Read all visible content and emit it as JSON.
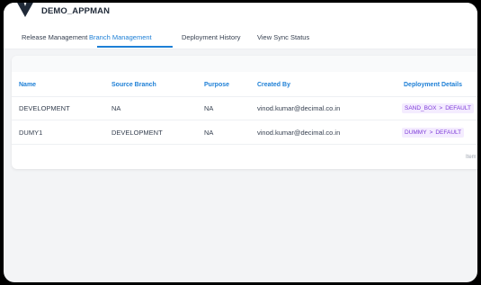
{
  "app": {
    "title": "DEMO_APPMAN"
  },
  "tabs": [
    {
      "label": "Release Management"
    },
    {
      "label": "Branch Management"
    },
    {
      "label": "Deployment History"
    },
    {
      "label": "View Sync Status"
    }
  ],
  "table": {
    "columns": [
      "Name",
      "Source Branch",
      "Purpose",
      "Created By",
      "Deployment Details"
    ],
    "rows": [
      {
        "name": "DEVELOPMENT",
        "source_branch": "NA",
        "purpose": "NA",
        "created_by": "vinod.kumar@decimal.co.in",
        "deploy_from": "SAND_BOX",
        "deploy_to": "DEFAULT",
        "arrow": ">"
      },
      {
        "name": "DUMY1",
        "source_branch": "DEVELOPMENT",
        "purpose": "NA",
        "created_by": "vinod.kumar@decimal.co.in",
        "deploy_from": "DUMMY",
        "deploy_to": "DEFAULT",
        "arrow": ">"
      }
    ]
  },
  "footer": {
    "items_label": "Item"
  },
  "colors": {
    "accent": "#1d7fd6",
    "chip_bg": "#f4ecff",
    "chip_text": "#7e3bd8"
  }
}
